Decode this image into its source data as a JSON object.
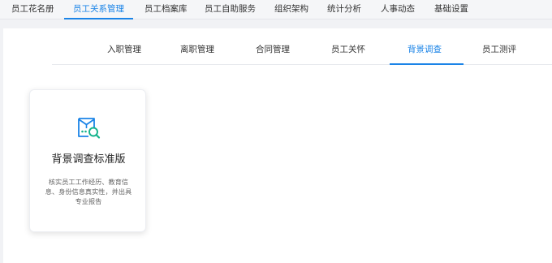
{
  "top_nav": {
    "items": [
      {
        "label": "员工花名册"
      },
      {
        "label": "员工关系管理",
        "active": true
      },
      {
        "label": "员工档案库"
      },
      {
        "label": "员工自助服务"
      },
      {
        "label": "组织架构"
      },
      {
        "label": "统计分析"
      },
      {
        "label": "人事动态"
      },
      {
        "label": "基础设置"
      }
    ]
  },
  "sub_nav": {
    "tabs": [
      {
        "label": "入职管理"
      },
      {
        "label": "离职管理"
      },
      {
        "label": "合同管理"
      },
      {
        "label": "员工关怀"
      },
      {
        "label": "背景调查",
        "active": true
      },
      {
        "label": "员工测评"
      }
    ]
  },
  "card": {
    "icon": "background-check-icon",
    "title": "背景调查标准版",
    "description": "核实员工工作经历、教育信息、身份信息真实性，并出具专业报告"
  },
  "colors": {
    "accent": "#1b84e7",
    "icon_teal": "#14b38c",
    "icon_blue": "#1b84e7"
  }
}
